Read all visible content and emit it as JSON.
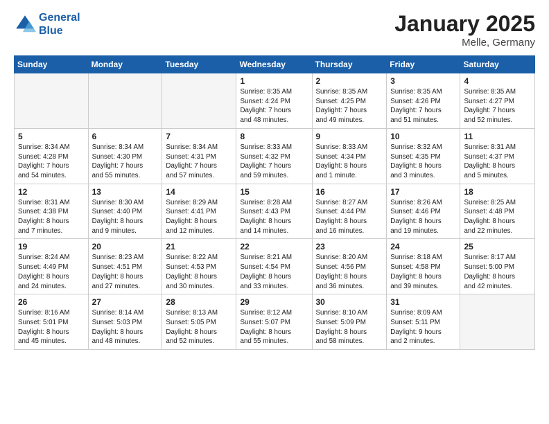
{
  "header": {
    "logo_line1": "General",
    "logo_line2": "Blue",
    "month": "January 2025",
    "location": "Melle, Germany"
  },
  "weekdays": [
    "Sunday",
    "Monday",
    "Tuesday",
    "Wednesday",
    "Thursday",
    "Friday",
    "Saturday"
  ],
  "weeks": [
    [
      {
        "day": "",
        "content": ""
      },
      {
        "day": "",
        "content": ""
      },
      {
        "day": "",
        "content": ""
      },
      {
        "day": "1",
        "content": "Sunrise: 8:35 AM\nSunset: 4:24 PM\nDaylight: 7 hours\nand 48 minutes."
      },
      {
        "day": "2",
        "content": "Sunrise: 8:35 AM\nSunset: 4:25 PM\nDaylight: 7 hours\nand 49 minutes."
      },
      {
        "day": "3",
        "content": "Sunrise: 8:35 AM\nSunset: 4:26 PM\nDaylight: 7 hours\nand 51 minutes."
      },
      {
        "day": "4",
        "content": "Sunrise: 8:35 AM\nSunset: 4:27 PM\nDaylight: 7 hours\nand 52 minutes."
      }
    ],
    [
      {
        "day": "5",
        "content": "Sunrise: 8:34 AM\nSunset: 4:28 PM\nDaylight: 7 hours\nand 54 minutes."
      },
      {
        "day": "6",
        "content": "Sunrise: 8:34 AM\nSunset: 4:30 PM\nDaylight: 7 hours\nand 55 minutes."
      },
      {
        "day": "7",
        "content": "Sunrise: 8:34 AM\nSunset: 4:31 PM\nDaylight: 7 hours\nand 57 minutes."
      },
      {
        "day": "8",
        "content": "Sunrise: 8:33 AM\nSunset: 4:32 PM\nDaylight: 7 hours\nand 59 minutes."
      },
      {
        "day": "9",
        "content": "Sunrise: 8:33 AM\nSunset: 4:34 PM\nDaylight: 8 hours\nand 1 minute."
      },
      {
        "day": "10",
        "content": "Sunrise: 8:32 AM\nSunset: 4:35 PM\nDaylight: 8 hours\nand 3 minutes."
      },
      {
        "day": "11",
        "content": "Sunrise: 8:31 AM\nSunset: 4:37 PM\nDaylight: 8 hours\nand 5 minutes."
      }
    ],
    [
      {
        "day": "12",
        "content": "Sunrise: 8:31 AM\nSunset: 4:38 PM\nDaylight: 8 hours\nand 7 minutes."
      },
      {
        "day": "13",
        "content": "Sunrise: 8:30 AM\nSunset: 4:40 PM\nDaylight: 8 hours\nand 9 minutes."
      },
      {
        "day": "14",
        "content": "Sunrise: 8:29 AM\nSunset: 4:41 PM\nDaylight: 8 hours\nand 12 minutes."
      },
      {
        "day": "15",
        "content": "Sunrise: 8:28 AM\nSunset: 4:43 PM\nDaylight: 8 hours\nand 14 minutes."
      },
      {
        "day": "16",
        "content": "Sunrise: 8:27 AM\nSunset: 4:44 PM\nDaylight: 8 hours\nand 16 minutes."
      },
      {
        "day": "17",
        "content": "Sunrise: 8:26 AM\nSunset: 4:46 PM\nDaylight: 8 hours\nand 19 minutes."
      },
      {
        "day": "18",
        "content": "Sunrise: 8:25 AM\nSunset: 4:48 PM\nDaylight: 8 hours\nand 22 minutes."
      }
    ],
    [
      {
        "day": "19",
        "content": "Sunrise: 8:24 AM\nSunset: 4:49 PM\nDaylight: 8 hours\nand 24 minutes."
      },
      {
        "day": "20",
        "content": "Sunrise: 8:23 AM\nSunset: 4:51 PM\nDaylight: 8 hours\nand 27 minutes."
      },
      {
        "day": "21",
        "content": "Sunrise: 8:22 AM\nSunset: 4:53 PM\nDaylight: 8 hours\nand 30 minutes."
      },
      {
        "day": "22",
        "content": "Sunrise: 8:21 AM\nSunset: 4:54 PM\nDaylight: 8 hours\nand 33 minutes."
      },
      {
        "day": "23",
        "content": "Sunrise: 8:20 AM\nSunset: 4:56 PM\nDaylight: 8 hours\nand 36 minutes."
      },
      {
        "day": "24",
        "content": "Sunrise: 8:18 AM\nSunset: 4:58 PM\nDaylight: 8 hours\nand 39 minutes."
      },
      {
        "day": "25",
        "content": "Sunrise: 8:17 AM\nSunset: 5:00 PM\nDaylight: 8 hours\nand 42 minutes."
      }
    ],
    [
      {
        "day": "26",
        "content": "Sunrise: 8:16 AM\nSunset: 5:01 PM\nDaylight: 8 hours\nand 45 minutes."
      },
      {
        "day": "27",
        "content": "Sunrise: 8:14 AM\nSunset: 5:03 PM\nDaylight: 8 hours\nand 48 minutes."
      },
      {
        "day": "28",
        "content": "Sunrise: 8:13 AM\nSunset: 5:05 PM\nDaylight: 8 hours\nand 52 minutes."
      },
      {
        "day": "29",
        "content": "Sunrise: 8:12 AM\nSunset: 5:07 PM\nDaylight: 8 hours\nand 55 minutes."
      },
      {
        "day": "30",
        "content": "Sunrise: 8:10 AM\nSunset: 5:09 PM\nDaylight: 8 hours\nand 58 minutes."
      },
      {
        "day": "31",
        "content": "Sunrise: 8:09 AM\nSunset: 5:11 PM\nDaylight: 9 hours\nand 2 minutes."
      },
      {
        "day": "",
        "content": ""
      }
    ]
  ]
}
